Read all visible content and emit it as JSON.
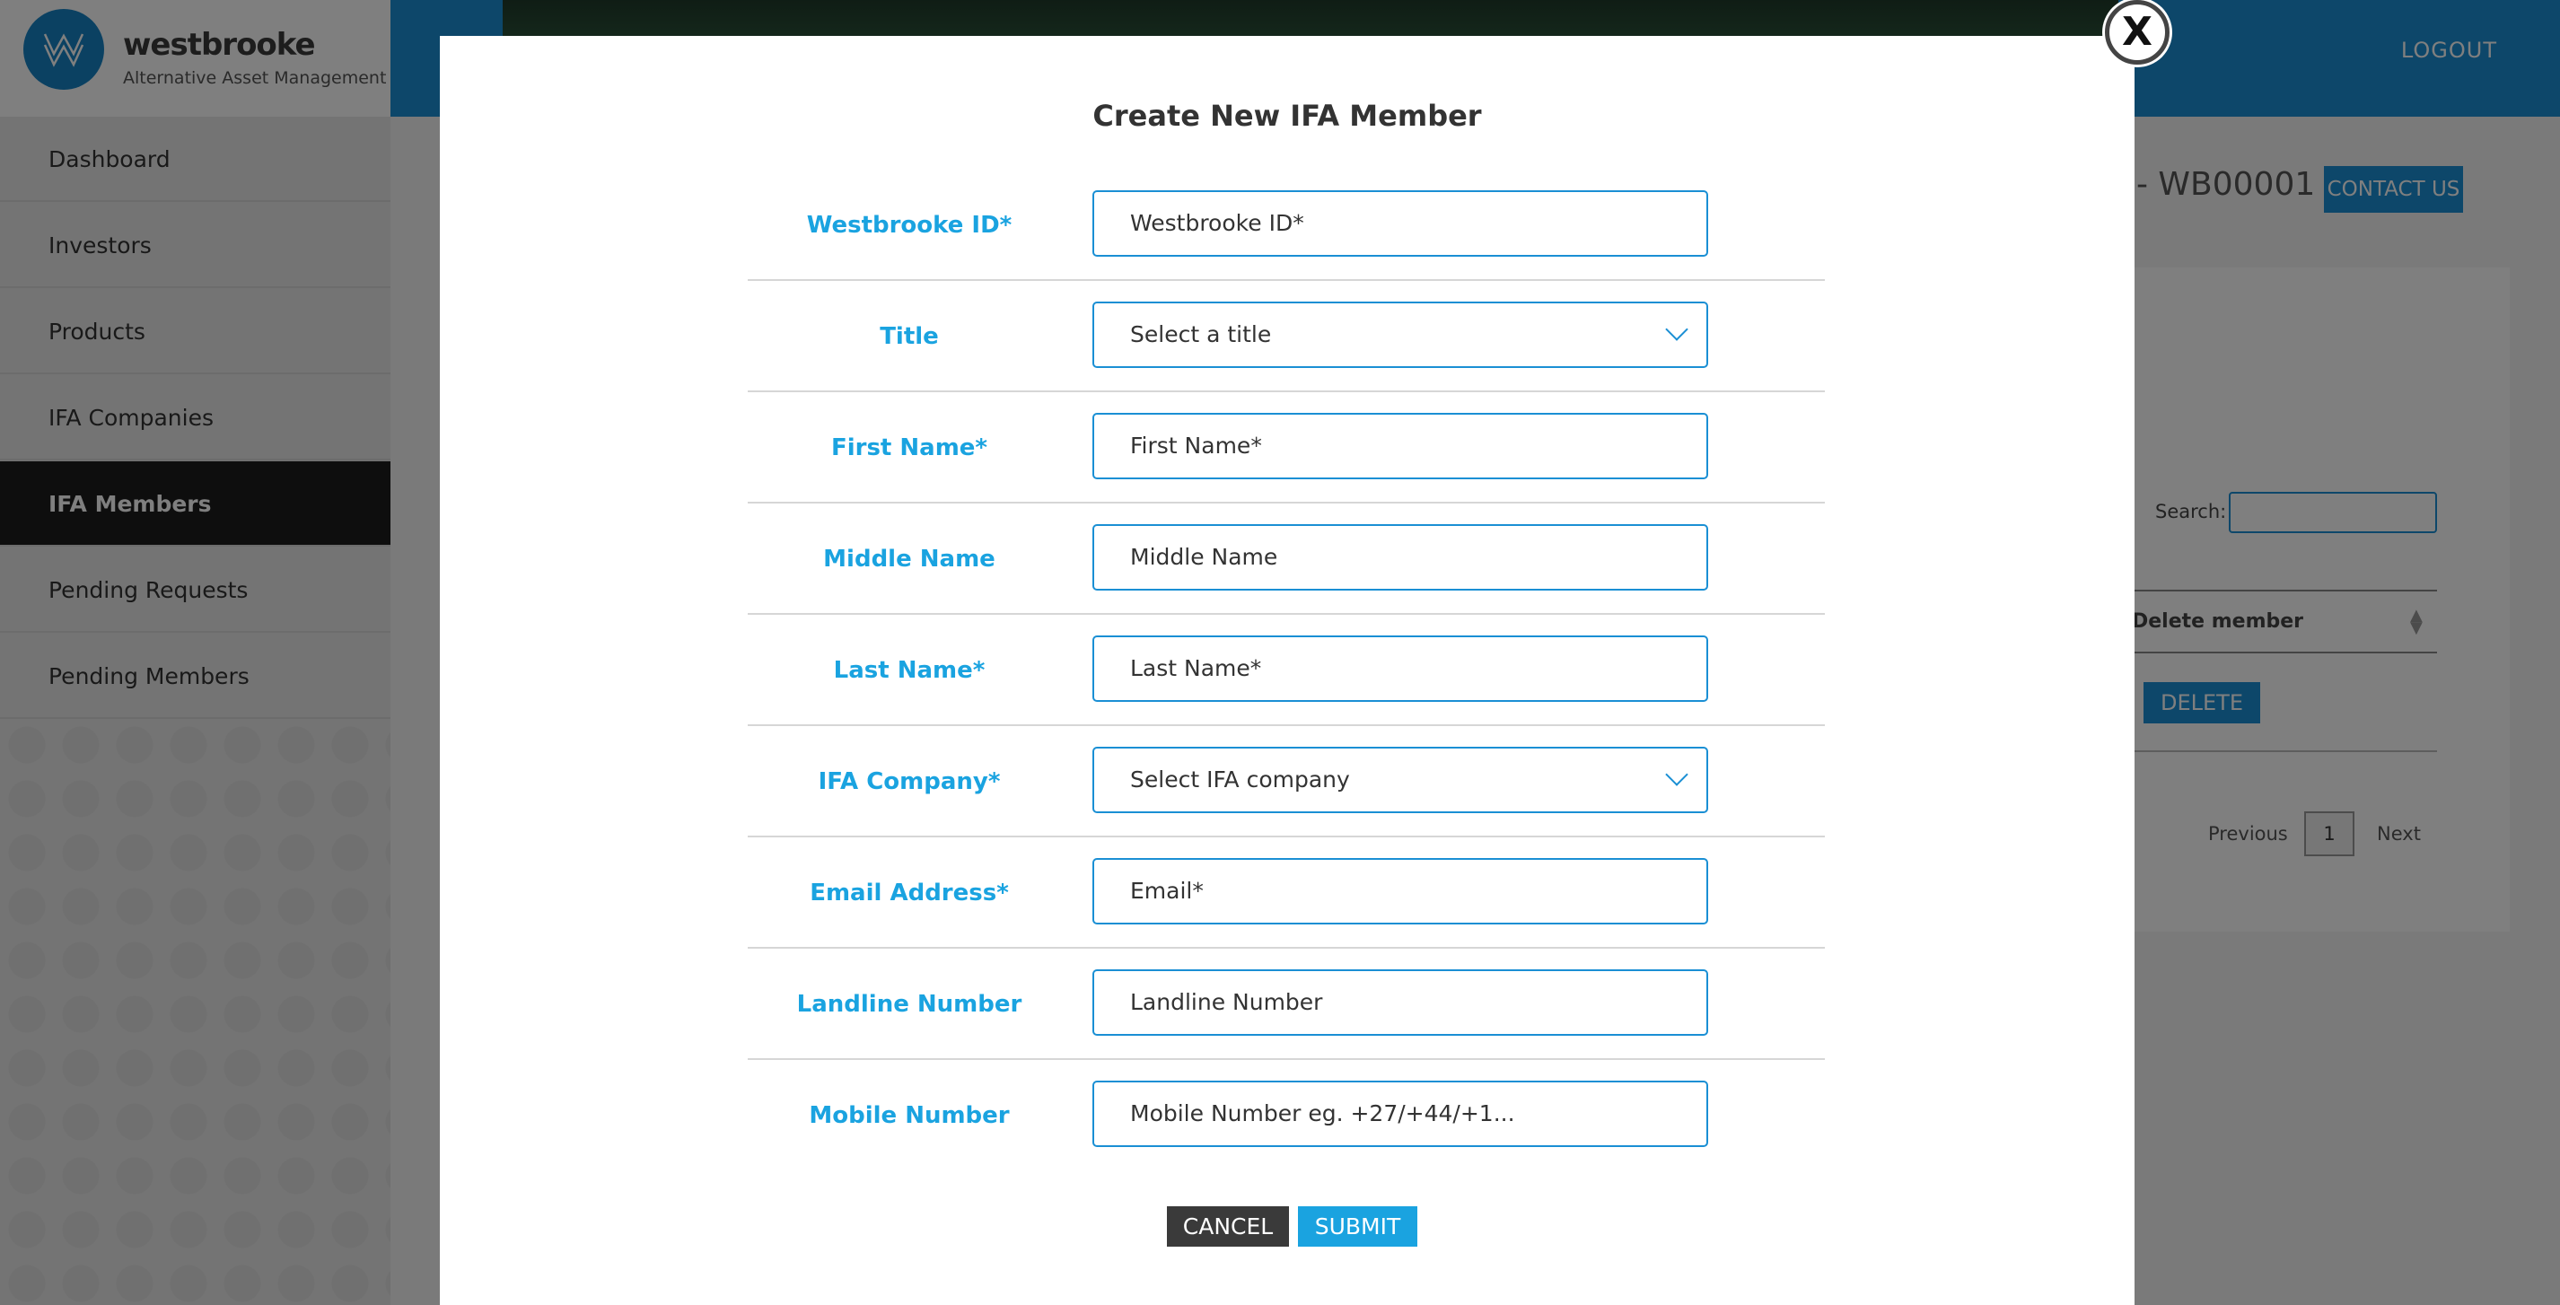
{
  "brand": {
    "name": "westbrooke",
    "tagline": "Alternative Asset Management"
  },
  "header": {
    "logout_label": "LOGOUT"
  },
  "sidebar": {
    "items": [
      {
        "label": "Dashboard"
      },
      {
        "label": "Investors"
      },
      {
        "label": "Products"
      },
      {
        "label": "IFA Companies"
      },
      {
        "label": "IFA Members",
        "active": true
      },
      {
        "label": "Pending Requests"
      },
      {
        "label": "Pending Members"
      }
    ]
  },
  "main": {
    "page_id": "- WB00001",
    "contact_label": "CONTACT US",
    "search_label": "Search:",
    "table_header_delete": "Delete member",
    "delete_label": "DELETE",
    "pagination": {
      "previous": "Previous",
      "current": "1",
      "next": "Next"
    }
  },
  "modal": {
    "close_label": "X",
    "title": "Create New IFA Member",
    "fields": [
      {
        "label": "Westbrooke ID*",
        "placeholder": "Westbrooke ID*",
        "type": "text"
      },
      {
        "label": "Title",
        "placeholder": "Select a title",
        "type": "select"
      },
      {
        "label": "First Name*",
        "placeholder": "First Name*",
        "type": "text"
      },
      {
        "label": "Middle Name",
        "placeholder": "Middle Name",
        "type": "text"
      },
      {
        "label": "Last Name*",
        "placeholder": "Last Name*",
        "type": "text"
      },
      {
        "label": "IFA Company*",
        "placeholder": "Select IFA company",
        "type": "select"
      },
      {
        "label": "Email Address*",
        "placeholder": "Email*",
        "type": "text"
      },
      {
        "label": "Landline Number",
        "placeholder": "Landline Number",
        "type": "text"
      },
      {
        "label": "Mobile Number",
        "placeholder": "Mobile Number eg. +27/+44/+1...",
        "type": "text"
      }
    ],
    "cancel_label": "CANCEL",
    "submit_label": "SUBMIT"
  },
  "colors": {
    "accent": "#1a8fd4",
    "label_blue": "#1aa3e0",
    "dark": "#1c1c1c"
  }
}
